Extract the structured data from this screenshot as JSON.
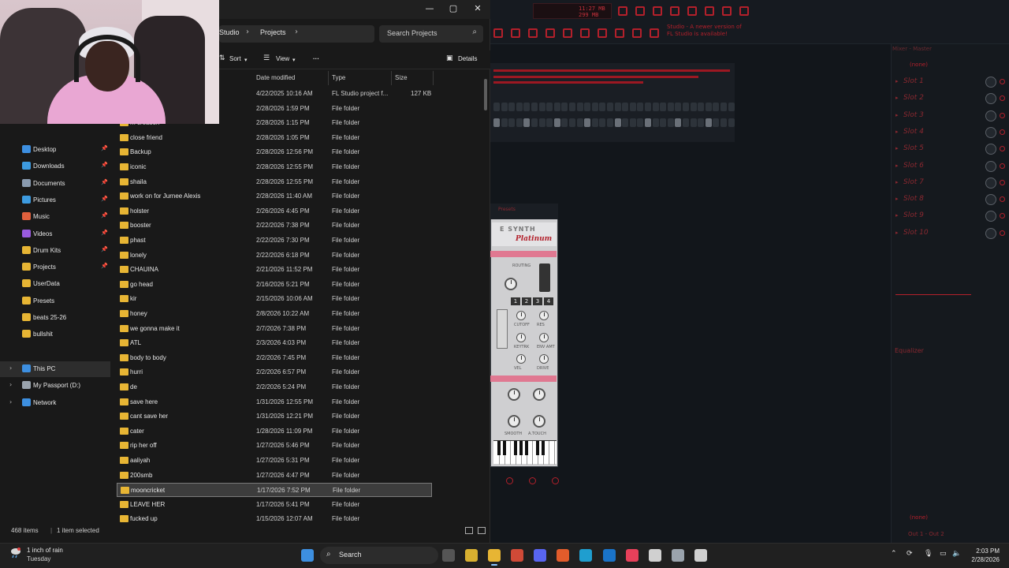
{
  "explorer": {
    "breadcrumb": [
      "Studio",
      "Projects"
    ],
    "search_placeholder": "Search Projects",
    "commands": {
      "sort": "Sort",
      "view": "View",
      "more": "···",
      "details": "Details"
    },
    "columns": {
      "date": "Date modified",
      "type": "Type",
      "size": "Size"
    },
    "nav": [
      {
        "label": "Desktop",
        "color": "#3d8fe0",
        "pinned": true
      },
      {
        "label": "Downloads",
        "color": "#3d9be0",
        "pinned": true
      },
      {
        "label": "Documents",
        "color": "#8a9bb0",
        "pinned": true
      },
      {
        "label": "Pictures",
        "color": "#3d9be0",
        "pinned": true
      },
      {
        "label": "Music",
        "color": "#e0603d",
        "pinned": true
      },
      {
        "label": "Videos",
        "color": "#9a5be0",
        "pinned": true
      },
      {
        "label": "Drum Kits",
        "color": "#e7b534",
        "pinned": true
      },
      {
        "label": "Projects",
        "color": "#e7b534",
        "pinned": true
      },
      {
        "label": "UserData",
        "color": "#e7b534",
        "pinned": false
      },
      {
        "label": "Presets",
        "color": "#e7b534",
        "pinned": false
      },
      {
        "label": "beats 25-26",
        "color": "#e7b534",
        "pinned": false
      },
      {
        "label": "bullshit",
        "color": "#e7b534",
        "pinned": false
      }
    ],
    "nav_roots": [
      {
        "label": "This PC",
        "color": "#3d8fe0"
      },
      {
        "label": "My Passport (D:)",
        "color": "#9aa3ad"
      },
      {
        "label": "Network",
        "color": "#3d8fe0"
      }
    ],
    "files": [
      {
        "name": "",
        "date": "4/22/2025 10:16 AM",
        "type": "FL Studio project f...",
        "size": "127 KB",
        "project": true
      },
      {
        "name": "",
        "date": "2/28/2026 1:59 PM",
        "type": "File folder",
        "size": ""
      },
      {
        "name": "m creation",
        "date": "2/28/2026 1:15 PM",
        "type": "File folder",
        "size": ""
      },
      {
        "name": "close friend",
        "date": "2/28/2026 1:05 PM",
        "type": "File folder",
        "size": ""
      },
      {
        "name": "Backup",
        "date": "2/28/2026 12:56 PM",
        "type": "File folder",
        "size": ""
      },
      {
        "name": "iconic",
        "date": "2/28/2026 12:55 PM",
        "type": "File folder",
        "size": ""
      },
      {
        "name": "shaila",
        "date": "2/28/2026 12:55 PM",
        "type": "File folder",
        "size": ""
      },
      {
        "name": "work on for Jurnee Alexis",
        "date": "2/28/2026 11:40 AM",
        "type": "File folder",
        "size": ""
      },
      {
        "name": "holster",
        "date": "2/26/2026 4:45 PM",
        "type": "File folder",
        "size": ""
      },
      {
        "name": "booster",
        "date": "2/22/2026 7:38 PM",
        "type": "File folder",
        "size": ""
      },
      {
        "name": "phast",
        "date": "2/22/2026 7:30 PM",
        "type": "File folder",
        "size": ""
      },
      {
        "name": "lonely",
        "date": "2/22/2026 6:18 PM",
        "type": "File folder",
        "size": ""
      },
      {
        "name": "CHAUINA",
        "date": "2/21/2026 11:52 PM",
        "type": "File folder",
        "size": ""
      },
      {
        "name": "go head",
        "date": "2/16/2026 5:21 PM",
        "type": "File folder",
        "size": ""
      },
      {
        "name": "kir",
        "date": "2/15/2026 10:06 AM",
        "type": "File folder",
        "size": ""
      },
      {
        "name": "honey",
        "date": "2/8/2026 10:22 AM",
        "type": "File folder",
        "size": ""
      },
      {
        "name": "we gonna make it",
        "date": "2/7/2026 7:38 PM",
        "type": "File folder",
        "size": ""
      },
      {
        "name": "ATL",
        "date": "2/3/2026 4:03 PM",
        "type": "File folder",
        "size": ""
      },
      {
        "name": "body to body",
        "date": "2/2/2026 7:45 PM",
        "type": "File folder",
        "size": ""
      },
      {
        "name": "hurri",
        "date": "2/2/2026 6:57 PM",
        "type": "File folder",
        "size": ""
      },
      {
        "name": "de",
        "date": "2/2/2026 5:24 PM",
        "type": "File folder",
        "size": ""
      },
      {
        "name": "save here",
        "date": "1/31/2026 12:55 PM",
        "type": "File folder",
        "size": ""
      },
      {
        "name": "cant save her",
        "date": "1/31/2026 12:21 PM",
        "type": "File folder",
        "size": ""
      },
      {
        "name": "cater",
        "date": "1/28/2026 11:09 PM",
        "type": "File folder",
        "size": ""
      },
      {
        "name": "rip her off",
        "date": "1/27/2026 5:46 PM",
        "type": "File folder",
        "size": ""
      },
      {
        "name": "aaliyah",
        "date": "1/27/2026 5:31 PM",
        "type": "File folder",
        "size": ""
      },
      {
        "name": "200smb",
        "date": "1/27/2026 4:47 PM",
        "type": "File folder",
        "size": ""
      },
      {
        "name": "mooncricket",
        "date": "1/17/2026 7:52 PM",
        "type": "File folder",
        "size": "",
        "selected": true
      },
      {
        "name": "LEAVE HER",
        "date": "1/17/2026 5:41 PM",
        "type": "File folder",
        "size": ""
      },
      {
        "name": "fucked up",
        "date": "1/15/2026 12:07 AM",
        "type": "File folder",
        "size": ""
      }
    ],
    "status": {
      "count": "468 items",
      "selected": "1 item selected"
    }
  },
  "fl": {
    "news": [
      "Studio - A newer version of",
      "FL Studio is available!"
    ],
    "meter": [
      "11:27 MB",
      "299 MB"
    ],
    "mixer_title": "Mixer - Master",
    "none_label": "(none)",
    "slots": [
      "Slot 1",
      "Slot 2",
      "Slot 3",
      "Slot 4",
      "Slot 5",
      "Slot 6",
      "Slot 7",
      "Slot 8",
      "Slot 9",
      "Slot 10"
    ],
    "equalizer": "Equalizer",
    "output": "Out 1 - Out 2",
    "synth": {
      "logo1": "E SYNTH",
      "logo2": "Platinum",
      "routing": "ROUTING",
      "tabs": [
        "1",
        "2",
        "3",
        "4"
      ],
      "labels": [
        "CUTOFF",
        "RES",
        "KEYTRK",
        "ENV AMT",
        "VEL",
        "DRIVE",
        "SMOOTH",
        "A.TOUCH"
      ],
      "window_title": "Presets"
    }
  },
  "taskbar": {
    "weather_title": "1 inch of rain",
    "weather_sub": "Tuesday",
    "search": "Search",
    "time": "2:03 PM",
    "date": "2/28/2026",
    "apps": [
      {
        "name": "windows-start",
        "color": "#3d8fe0"
      },
      {
        "name": "widgets",
        "color": "#7a8f3a"
      },
      {
        "name": "task-view",
        "color": "#555"
      },
      {
        "name": "app-circle",
        "color": "#d8b030"
      },
      {
        "name": "file-explorer",
        "color": "#e7b534"
      },
      {
        "name": "chrome",
        "color": "#d04a37"
      },
      {
        "name": "discord",
        "color": "#5865f2"
      },
      {
        "name": "fl-studio",
        "color": "#e25c2b"
      },
      {
        "name": "edge",
        "color": "#1f9ecf"
      },
      {
        "name": "outlook",
        "color": "#1a73c8"
      },
      {
        "name": "itunes",
        "color": "#e8405a"
      },
      {
        "name": "store",
        "color": "#d0d0d0"
      },
      {
        "name": "settings",
        "color": "#9aa3ad"
      },
      {
        "name": "media-player",
        "color": "#d0d0d0"
      }
    ]
  }
}
